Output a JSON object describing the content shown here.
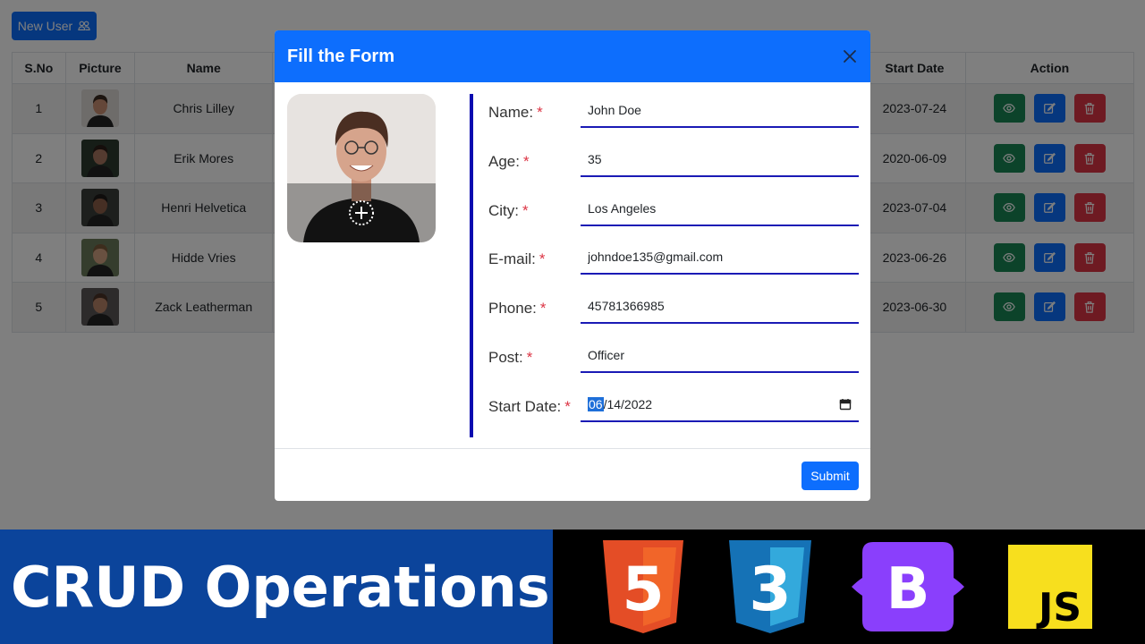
{
  "app": {
    "new_user_label": "New User",
    "table": {
      "headers": {
        "sno": "S.No",
        "picture": "Picture",
        "name": "Name",
        "start_date": "Start Date",
        "action": "Action"
      },
      "rows": [
        {
          "sno": "1",
          "name": "Chris Lilley",
          "start_date": "2023-07-24"
        },
        {
          "sno": "2",
          "name": "Erik Mores",
          "start_date": "2020-06-09"
        },
        {
          "sno": "3",
          "name": "Henri Helvetica",
          "start_date": "2023-07-04"
        },
        {
          "sno": "4",
          "name": "Hidde Vries",
          "start_date": "2023-06-26"
        },
        {
          "sno": "5",
          "name": "Zack Leatherman",
          "start_date": "2023-06-30"
        }
      ]
    }
  },
  "modal": {
    "title": "Fill the Form",
    "fields": {
      "name": {
        "label": "Name:",
        "value": "John Doe"
      },
      "age": {
        "label": "Age:",
        "value": "35"
      },
      "city": {
        "label": "City:",
        "value": "Los Angeles"
      },
      "email": {
        "label": "E-mail:",
        "value": "johndoe135@gmail.com"
      },
      "phone": {
        "label": "Phone:",
        "value": "45781366985"
      },
      "post": {
        "label": "Post:",
        "value": "Officer"
      },
      "start_date": {
        "label": "Start Date:",
        "month": "06",
        "rest": "/14/2022"
      }
    },
    "required_mark": "*",
    "submit_label": "Submit"
  },
  "banner": {
    "title": "CRUD Operations",
    "logos": {
      "html": "5",
      "css": "3",
      "bootstrap": "B",
      "js": "JS"
    }
  },
  "colors": {
    "primary": "#0d6efd",
    "success": "#198754",
    "danger": "#dc3545",
    "banner_blue": "#0b449b",
    "html_orange": "#e44d26",
    "css_blue": "#1572b6",
    "bootstrap_purple": "#7952b3",
    "js_yellow": "#f7df1e"
  },
  "icons": {
    "new_user": "users-icon",
    "close": "close-icon",
    "view": "eye-icon",
    "edit": "edit-icon",
    "delete": "trash-icon",
    "upload": "add-photo-icon",
    "calendar": "calendar-icon"
  }
}
